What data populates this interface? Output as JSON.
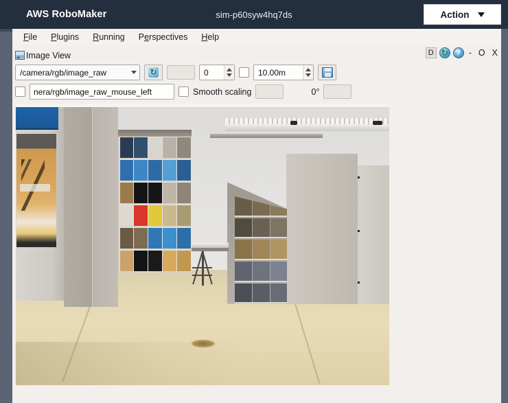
{
  "appbar": {
    "brand": "AWS RoboMaker",
    "simulation_id": "sim-p60syw4hq7ds",
    "action_label": "Action",
    "caret_icon": "caret-down-icon"
  },
  "menubar": {
    "items": [
      {
        "pre": "",
        "mnemonic": "F",
        "post": "ile"
      },
      {
        "pre": "",
        "mnemonic": "P",
        "post": "lugins"
      },
      {
        "pre": "",
        "mnemonic": "R",
        "post": "unning"
      },
      {
        "pre": "P",
        "mnemonic": "e",
        "post": "rspectives"
      },
      {
        "pre": "",
        "mnemonic": "H",
        "post": "elp"
      }
    ]
  },
  "panel": {
    "title": "Image View",
    "icon": "image-view-icon",
    "header_buttons": {
      "detach_label": "D",
      "refresh_icon": "refresh-icon",
      "help_icon": "help-icon",
      "minimize_label": "-",
      "maximize_label": "O",
      "close_label": "X"
    },
    "toolbar_row1": {
      "topic_value": "/camera/rgb/image_raw",
      "refresh_icon": "refresh-icon",
      "blank_field_value": "",
      "queue_size_value": "0",
      "publish_checkbox_checked": false,
      "max_range_value": "10.00m",
      "save_icon": "save-image-icon"
    },
    "toolbar_row2": {
      "mouse_pub_checkbox_checked": false,
      "mouse_topic_value": "nera/rgb/image_raw_mouse_left",
      "smooth_scaling_checkbox_checked": false,
      "smooth_scaling_label": "Smooth scaling",
      "blank_field_value": "",
      "rotation_label": "0°",
      "rotation_field_value": ""
    }
  },
  "camera_view": {
    "name": "camera-image-stream",
    "description": "3D simulated warehouse interior: tan plywood floor, gray pillar, shelving with boxes, table with tripod legs, ceiling beams",
    "colors": {
      "floor": "#e3d7b3",
      "wall": "#dcdbd9",
      "pillar": "#b1aca4",
      "poster_blue": "#1f63a8",
      "poster_orange": "#d9a45a"
    },
    "shelf_boxes": [
      [
        "#2b3c52",
        "#32506e",
        "#d8d5ce",
        "#b8b2a8",
        "#8e887e"
      ],
      [
        "#2f6fae",
        "#3e86c4",
        "#2d6ba8",
        "#54a0d6",
        "#2a5f94"
      ],
      [
        "#9a7b4c",
        "#141414",
        "#161616",
        "#bfb6a6",
        "#8e8577"
      ],
      [
        "#ded9cf",
        "#d9352c",
        "#e0c83a",
        "#c9b98d",
        "#a99b73"
      ],
      [
        "#6b5b45",
        "#7d6c52",
        "#2f78b8",
        "#3d8fce",
        "#2d6ea8"
      ],
      [
        "#caa26a",
        "#141414",
        "#1a1a1a",
        "#d8a85e",
        "#c29750"
      ]
    ],
    "angled_shelf_rows": [
      [
        "#6a5c46",
        "#7a6a50",
        "#8b7a5c"
      ],
      [
        "#514a3e",
        "#6a6152",
        "#7e7462"
      ],
      [
        "#8a7348",
        "#a08656",
        "#b09562"
      ],
      [
        "#5f6470",
        "#6e7380",
        "#7d8290"
      ],
      [
        "#4a4f58",
        "#585d66",
        "#676c75"
      ]
    ]
  }
}
